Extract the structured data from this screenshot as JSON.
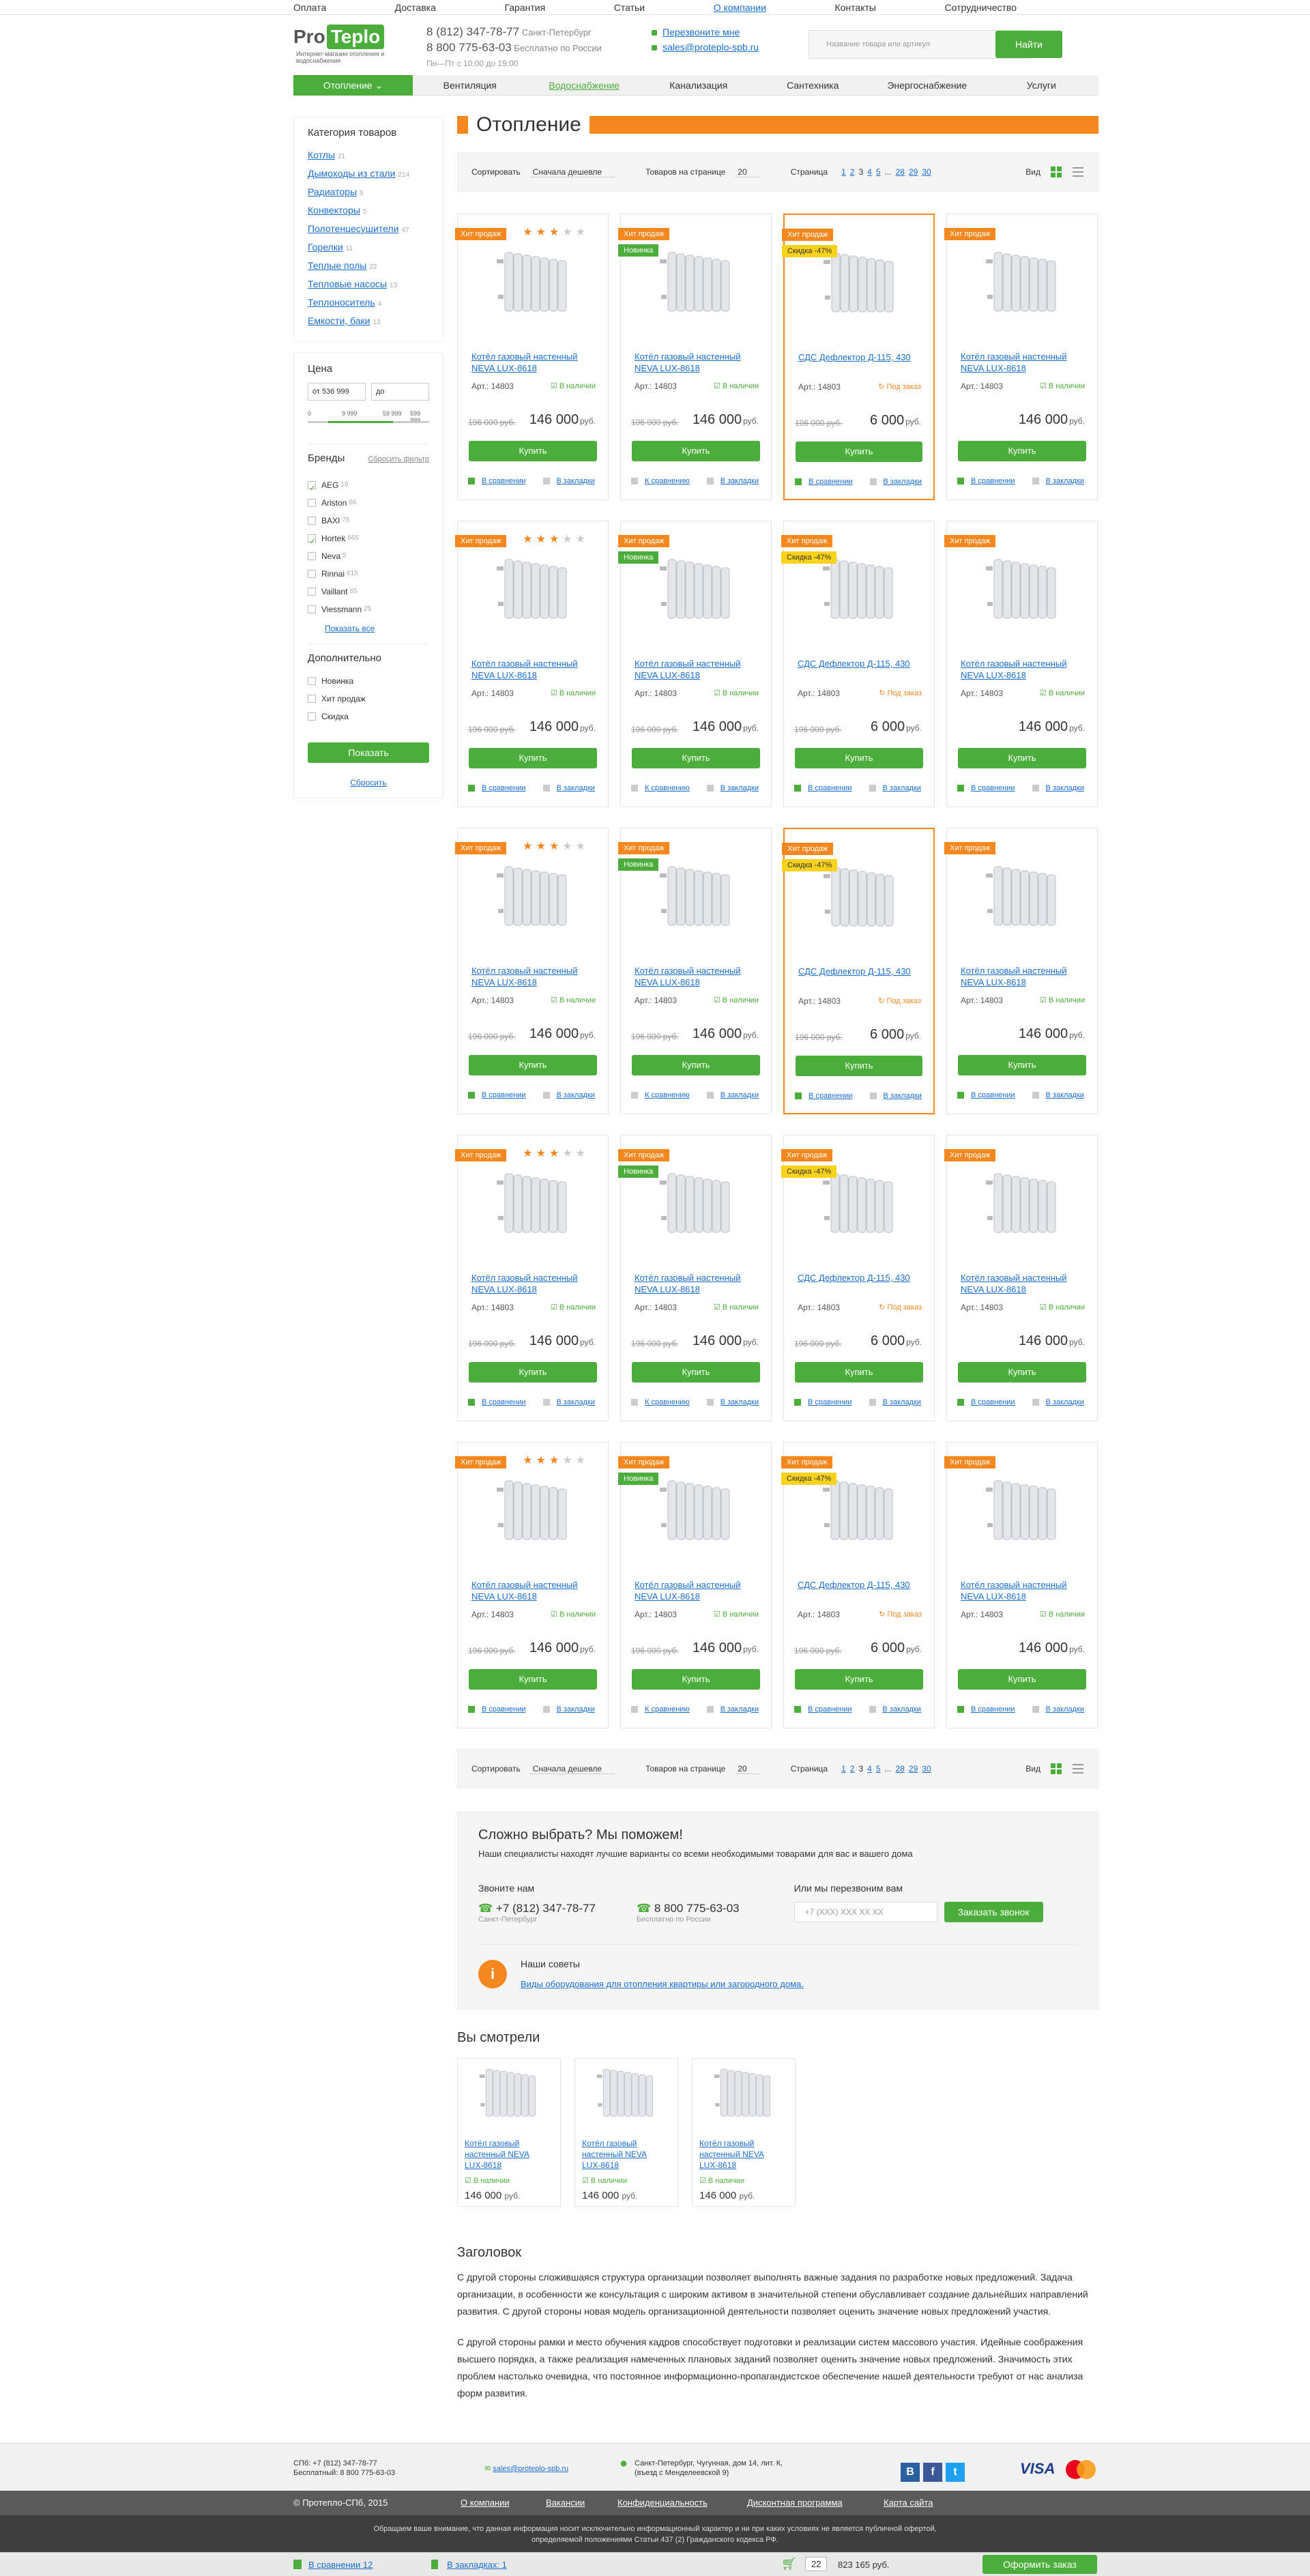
{
  "topnav": [
    "Оплата",
    "Доставка",
    "Гарантия",
    "Статьи",
    "О компании",
    "Контакты",
    "Сотрудничество"
  ],
  "logo": {
    "pro": "Pro",
    "teplo": "Teplo",
    "sub": "Интернет-магазин отопления и водоснабжения"
  },
  "phones": {
    "p1": "8 (812) 347-78-77",
    "c1": "Санкт-Петербург",
    "p2": "8 800 775-63-03",
    "c2": "Бесплатно по России",
    "hours": "Пн—Пт с 10:00 до 19:00"
  },
  "contacts": {
    "callback": "Перезвоните мне",
    "email": "sales@proteplo-spb.ru"
  },
  "search": {
    "placeholder": "Название товара или артикул",
    "button": "Найти"
  },
  "mainnav": [
    "Отопление",
    "Вентиляция",
    "Водоснабжение",
    "Канализация",
    "Сантехника",
    "Энергоснабжение",
    "Услуги"
  ],
  "sidebar": {
    "cat_title": "Категория товаров",
    "categories": [
      {
        "n": "Котлы",
        "c": "21"
      },
      {
        "n": "Дымоходы из стали",
        "c": "214"
      },
      {
        "n": "Радиаторы",
        "c": "5"
      },
      {
        "n": "Конвекторы",
        "c": "5"
      },
      {
        "n": "Полотенцесушители",
        "c": "47"
      },
      {
        "n": "Горелки",
        "c": "11"
      },
      {
        "n": "Теплые полы",
        "c": "22"
      },
      {
        "n": "Тепловые насосы",
        "c": "13"
      },
      {
        "n": "Теплоноситель",
        "c": "4"
      },
      {
        "n": "Емкости, баки",
        "c": "13"
      }
    ],
    "price_title": "Цена",
    "price_from": "от   536 999",
    "price_to": "до",
    "range": [
      "0",
      "9 999",
      "59 999",
      "599 999"
    ],
    "brands_title": "Бренды",
    "reset_filter": "Сбросить фильтр",
    "brands": [
      {
        "n": "AEG",
        "c": "19",
        "on": true
      },
      {
        "n": "Ariston",
        "c": "66",
        "on": false
      },
      {
        "n": "BAXI",
        "c": "75",
        "on": false
      },
      {
        "n": "Hortek",
        "c": "665",
        "on": true
      },
      {
        "n": "Neva",
        "c": "5",
        "on": false
      },
      {
        "n": "Rinnai",
        "c": "615",
        "on": false
      },
      {
        "n": "Vaillant",
        "c": "65",
        "on": false
      },
      {
        "n": "Viessmann",
        "c": "25",
        "on": false
      }
    ],
    "show_all": "Показать все",
    "extra_title": "Дополнительно",
    "extra": [
      "Новинка",
      "Хит продаж",
      "Скидка"
    ],
    "show_btn": "Показать",
    "reset": "Сбросить"
  },
  "page_title": "Отопление",
  "sortbar": {
    "sort_label": "Сортировать",
    "sort_value": "Сначала дешевле",
    "per_label": "Товаров на странице",
    "per_value": "20",
    "page_label": "Страница",
    "pages": [
      "1",
      "2",
      "3",
      "4",
      "5",
      "...",
      "28",
      "29",
      "30"
    ],
    "view_label": "Вид"
  },
  "products": {
    "hit": "Хит продаж",
    "new": "Новинка",
    "sale": "Скидка -47%",
    "boiler_name": "Котёл газовый настенный NEVA LUX-8618",
    "defl_name": "СДС Дефлектор Д-115, 430",
    "art": "Арт.: 14803",
    "in_stock": "В наличии",
    "on_order": "Под заказ",
    "old_price": "196 000 руб.",
    "price_boiler": "146 000",
    "price_defl": "6 000",
    "cur": "руб.",
    "buy": "Купить",
    "compare": "В сравнении",
    "to_compare": "К сравнению",
    "bookmarks": "В закладки"
  },
  "help": {
    "title": "Сложно выбрать? Мы поможем!",
    "sub": "Наши специалисты находят лучшие варианты со всеми необходимыми товарами для вас и вашего дома",
    "call_us": "Звоните нам",
    "p1": "+7 (812) 347-78-77",
    "c1": "Санкт-Петербург",
    "p2": "8 800 775-63-03",
    "c2": "Бесплатно по России",
    "call_back": "Или мы перезвоним вам",
    "phone_ph": "+7 (XXX) XXX XX XX",
    "order_call": "Заказать звонок",
    "advice_title": "Наши советы",
    "advice_link": "Виды оборудования для отопления квартиры или загородного дома."
  },
  "viewed": {
    "title": "Вы смотрели",
    "name": "Котёл газовый настенный NEVA LUX-8618",
    "stock": "В наличии",
    "price": "146 000",
    "cur": "руб."
  },
  "seo": {
    "title": "Заголовок",
    "p1": "С другой стороны сложившаяся структура организации позволяет выполнять важные задания по разработке новых предложений. Задача организации, в особенности же консультация с широким активом в значительной степени обуславливает создание дальнейших направлений развития. С другой стороны новая модель организационной деятельности позволяет оценить значение новых предложений участия.",
    "p2": "С другой стороны рамки и место обучения кадров способствует подготовки и реализации систем массового участия. Идейные соображения высшего порядка, а также реализация намеченных плановых заданий позволяет оценить значение новых предложений. Значимость этих проблем настолько очевидна, что постоянное информационно-пропагандистское обеспечение нашей деятельности требуют от нас анализа форм развития."
  },
  "footer": {
    "spb": "СПб: +7 (812) 347-78-77",
    "free": "Бесплатный: 8 800 775-63-03",
    "email": "sales@proteplo-spb.ru",
    "addr1": "Санкт-Петербург, Чугунная, дом 14, лит. К,",
    "addr2": "(въезд с Менделеевской 9)",
    "copy": "© Протепло-СПб, 2015",
    "links": [
      "О компании",
      "Вакансии",
      "Конфиденциальность",
      "Дисконтная программа",
      "Карта сайта"
    ],
    "disc1": "Обращаем ваше внимание, что данная информация носит исключительно информационный характер и ни при каких условиях не является публичной офертой,",
    "disc2": "определяемой положениями Статьи 437 (2) Гражданского кодекса РФ.",
    "visa": "VISA"
  },
  "basket": {
    "compare": "В сравнении 12",
    "bookmarks": "В закладках: 1",
    "qty": "22",
    "sum": "823 165 руб.",
    "order": "Оформить заказ"
  }
}
